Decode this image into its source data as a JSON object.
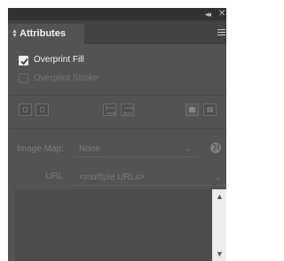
{
  "panel": {
    "title": "Attributes",
    "collapse_icon": "double-chevron-left-icon",
    "close_icon": "close-icon",
    "menu_icon": "hamburger-menu-icon",
    "colors": {
      "panel_bg": "#535353",
      "topbar_bg": "#323232",
      "tabstrip_bg": "#424242",
      "text_active": "#f4f4f4",
      "text_disabled": "#7b7b7b",
      "scrollbar_bg": "#ececec"
    }
  },
  "options": {
    "overprint_fill": {
      "label": "Overprint Fill",
      "checked": true,
      "enabled": true
    },
    "overprint_stroke": {
      "label": "Overprint Stroke",
      "checked": false,
      "enabled": false
    }
  },
  "toolbar": {
    "buttons": [
      {
        "name": "show-center-button",
        "icon": "square-center-icon"
      },
      {
        "name": "dont-show-center-button",
        "icon": "square-dot-icon"
      },
      {
        "name": "reverse-path-direction-off-button",
        "icon": "arrows-out-icon"
      },
      {
        "name": "reverse-path-direction-on-button",
        "icon": "arrows-in-icon"
      },
      {
        "name": "non-zero-winding-fill-button",
        "icon": "filled-square-icon"
      },
      {
        "name": "even-odd-fill-button",
        "icon": "filled-square-dark-icon"
      }
    ]
  },
  "image_map": {
    "label": "Image Map:",
    "value": "None",
    "browser_icon": "globe-icon"
  },
  "url": {
    "label": "URL:",
    "value": "<multiple URLs>"
  },
  "notes": {
    "value": "",
    "scroll_up_icon": "chevron-up-icon",
    "scroll_down_icon": "chevron-down-icon"
  }
}
